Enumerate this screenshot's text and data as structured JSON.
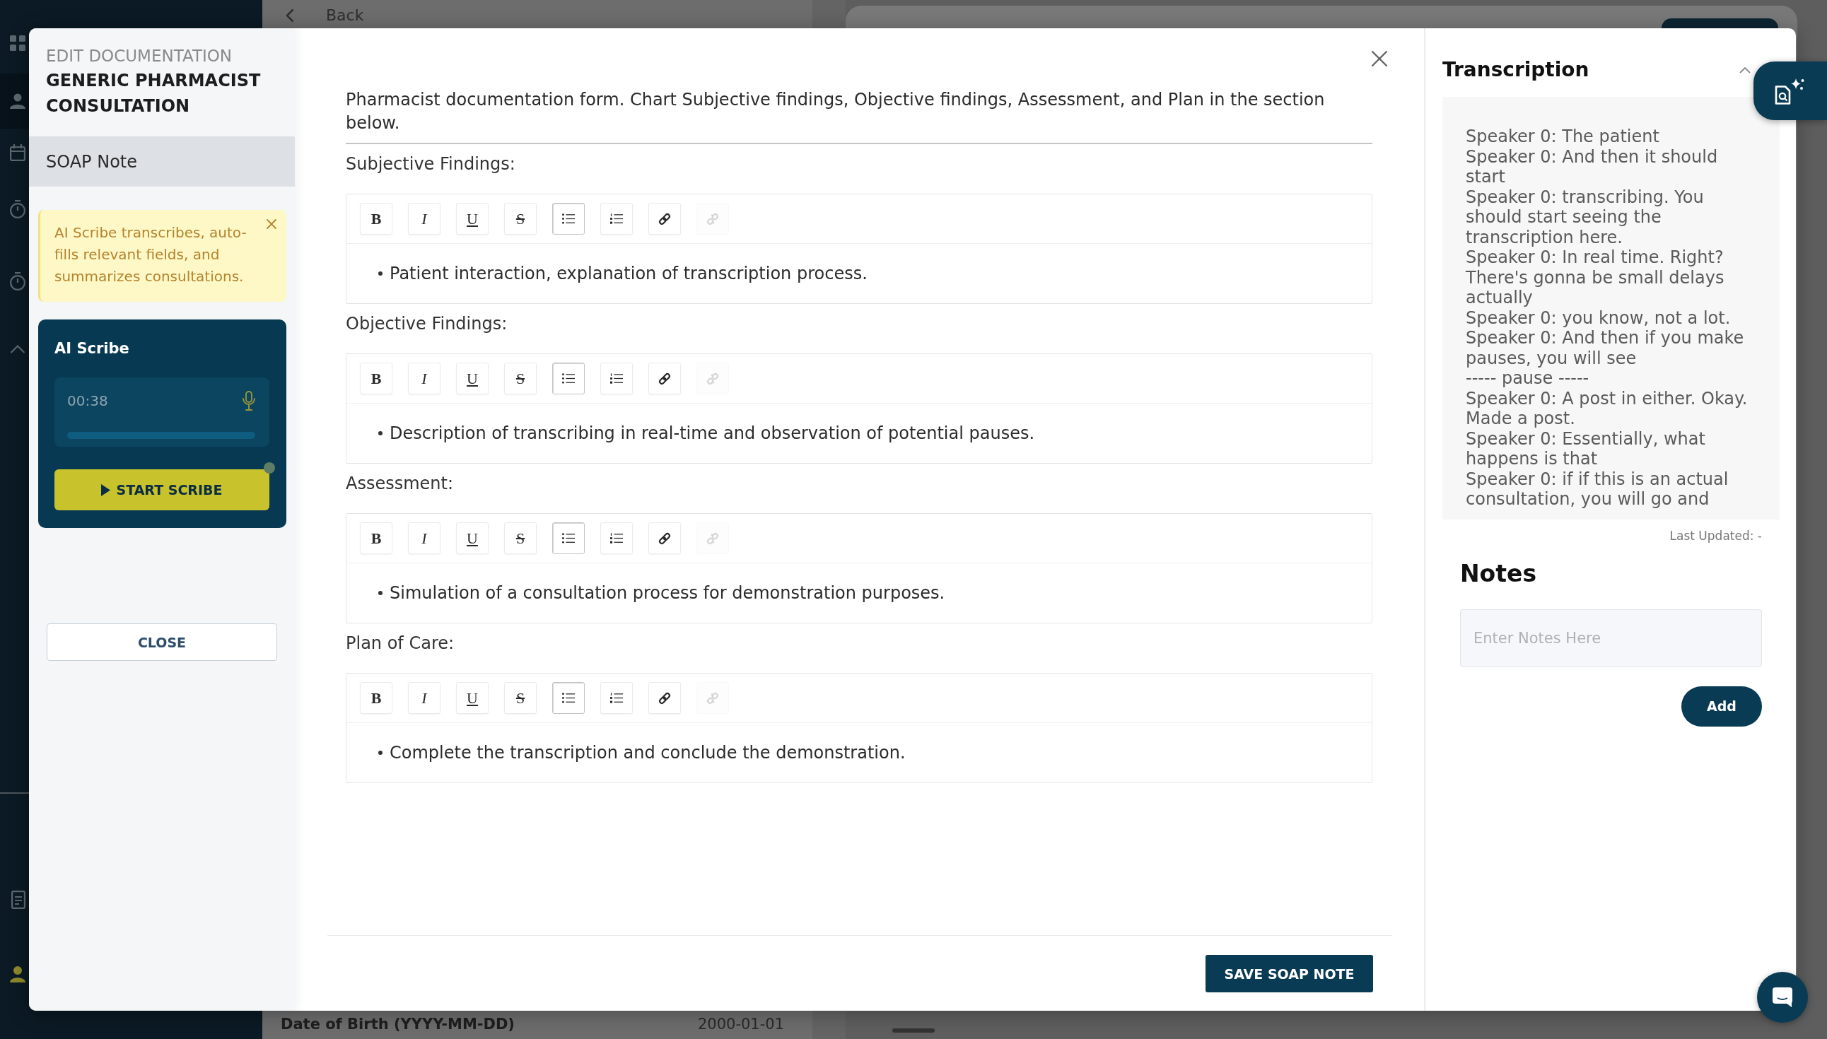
{
  "backdrop": {
    "back_link": "Back",
    "field_label": "Date of Birth (YYYY-MM-DD)",
    "field_value": "2000-01-01"
  },
  "sidebar": {
    "overline": "EDIT DOCUMENTATION",
    "title": "GENERIC PHARMACIST CONSULTATION",
    "items": [
      {
        "label": "SOAP Note",
        "selected": true
      }
    ],
    "alert": "AI Scribe transcribes, auto-fills relevant fields, and summarizes consultations.",
    "scribe": {
      "title": "AI Scribe",
      "elapsed": "00:38",
      "start_button": "START SCRIBE"
    },
    "close_button": "CLOSE"
  },
  "form": {
    "description": "Pharmacist documentation form. Chart Subjective findings, Objective findings, Assessment, and Plan in the section below.",
    "sections": [
      {
        "label": "Subjective Findings:",
        "toolbar": [
          {
            "kind": "bold",
            "label": "B",
            "selected": false,
            "disabled": false
          },
          {
            "kind": "italic",
            "label": "I",
            "selected": false,
            "disabled": false
          },
          {
            "kind": "underline",
            "label": "U",
            "selected": false,
            "disabled": false
          },
          {
            "kind": "strike",
            "label": "S",
            "selected": false,
            "disabled": false
          },
          {
            "kind": "bullet-list",
            "selected": true,
            "disabled": false
          },
          {
            "kind": "numbered-list",
            "selected": false,
            "disabled": false
          },
          {
            "kind": "link",
            "selected": false,
            "disabled": false
          },
          {
            "kind": "unlink",
            "selected": false,
            "disabled": true
          }
        ],
        "bullets": [
          "Patient interaction, explanation of transcription process."
        ]
      },
      {
        "label": "Objective Findings:",
        "toolbar": [
          {
            "kind": "bold",
            "label": "B",
            "selected": false,
            "disabled": false
          },
          {
            "kind": "italic",
            "label": "I",
            "selected": false,
            "disabled": false
          },
          {
            "kind": "underline",
            "label": "U",
            "selected": false,
            "disabled": false
          },
          {
            "kind": "strike",
            "label": "S",
            "selected": false,
            "disabled": false
          },
          {
            "kind": "bullet-list",
            "selected": true,
            "disabled": false
          },
          {
            "kind": "numbered-list",
            "selected": false,
            "disabled": false
          },
          {
            "kind": "link",
            "selected": false,
            "disabled": false
          },
          {
            "kind": "unlink",
            "selected": false,
            "disabled": true
          }
        ],
        "bullets": [
          "Description of transcribing in real-time and observation of potential pauses."
        ]
      },
      {
        "label": "Assessment:",
        "toolbar": [
          {
            "kind": "bold",
            "label": "B",
            "selected": false,
            "disabled": false
          },
          {
            "kind": "italic",
            "label": "I",
            "selected": false,
            "disabled": false
          },
          {
            "kind": "underline",
            "label": "U",
            "selected": false,
            "disabled": false
          },
          {
            "kind": "strike",
            "label": "S",
            "selected": false,
            "disabled": false
          },
          {
            "kind": "bullet-list",
            "selected": true,
            "disabled": false
          },
          {
            "kind": "numbered-list",
            "selected": false,
            "disabled": false
          },
          {
            "kind": "link",
            "selected": false,
            "disabled": false
          },
          {
            "kind": "unlink",
            "selected": false,
            "disabled": true
          }
        ],
        "bullets": [
          "Simulation of a consultation process for demonstration purposes."
        ]
      },
      {
        "label": "Plan of Care:",
        "toolbar": [
          {
            "kind": "bold",
            "label": "B",
            "selected": false,
            "disabled": false
          },
          {
            "kind": "italic",
            "label": "I",
            "selected": false,
            "disabled": false
          },
          {
            "kind": "underline",
            "label": "U",
            "selected": false,
            "disabled": false
          },
          {
            "kind": "strike",
            "label": "S",
            "selected": false,
            "disabled": false
          },
          {
            "kind": "bullet-list",
            "selected": true,
            "disabled": false
          },
          {
            "kind": "numbered-list",
            "selected": false,
            "disabled": false
          },
          {
            "kind": "link",
            "selected": false,
            "disabled": false
          },
          {
            "kind": "unlink",
            "selected": false,
            "disabled": true
          }
        ],
        "bullets": [
          "Complete the transcription and conclude the demonstration."
        ]
      }
    ],
    "save_button": "SAVE SOAP NOTE"
  },
  "transcription": {
    "title": "Transcription",
    "lines": [
      "Speaker 0: The patient",
      "Speaker 0: And then it should start",
      "Speaker 0: transcribing. You should start seeing the transcription here.",
      "Speaker 0: In real time. Right? There's gonna be small delays actually",
      "Speaker 0: you know, not a lot.",
      "Speaker 0: And then if you make pauses, you will see",
      "----- pause -----",
      "Speaker 0: A post in either. Okay. Made a post.",
      "Speaker 0: Essentially, what happens is that",
      "Speaker 0: if if this is an actual consultation, you will go and"
    ],
    "last_updated": "Last Updated: -"
  },
  "notes": {
    "title": "Notes",
    "placeholder": "Enter Notes Here",
    "add_button": "Add"
  }
}
